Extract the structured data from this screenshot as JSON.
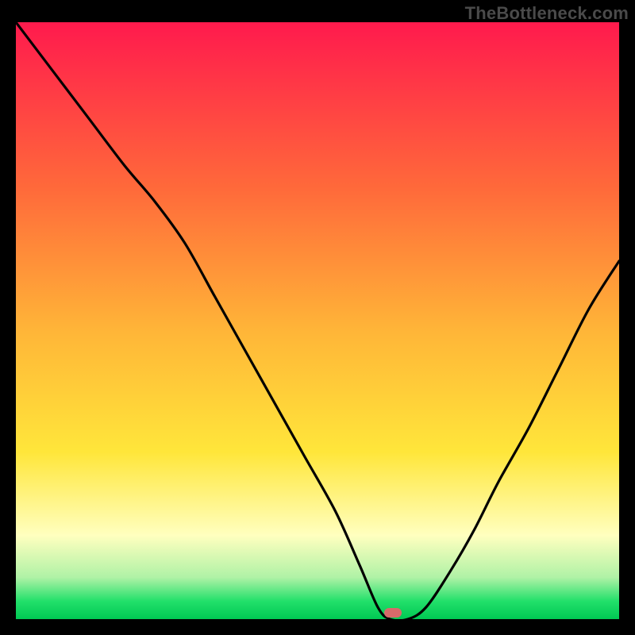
{
  "watermark": "TheBottleneck.com",
  "colors": {
    "top": "#ff1a4d",
    "mid1": "#ff6a3a",
    "mid2": "#ffb638",
    "mid3": "#ffe63a",
    "pale": "#ffffbf",
    "paleGreen": "#b0f2a6",
    "green": "#22e06a",
    "greenDeep": "#00c853",
    "curve": "#000000",
    "marker": "#d86a6a",
    "bg": "#000000"
  },
  "marker": {
    "x_pct": 62.5,
    "y_pct": 99.0
  },
  "chart_data": {
    "type": "line",
    "title": "",
    "xlabel": "",
    "ylabel": "",
    "xlim": [
      0,
      100
    ],
    "ylim": [
      0,
      100
    ],
    "grid": false,
    "x": [
      0,
      6,
      12,
      18,
      23,
      28,
      33,
      38,
      43,
      48,
      53,
      57,
      60,
      62,
      65,
      68,
      72,
      76,
      80,
      85,
      90,
      95,
      100
    ],
    "values": [
      100,
      92,
      84,
      76,
      70,
      63,
      54,
      45,
      36,
      27,
      18,
      9,
      2,
      0,
      0,
      2,
      8,
      15,
      23,
      32,
      42,
      52,
      60
    ],
    "series": [
      {
        "name": "bottleneck-curve",
        "values": [
          100,
          92,
          84,
          76,
          70,
          63,
          54,
          45,
          36,
          27,
          18,
          9,
          2,
          0,
          0,
          2,
          8,
          15,
          23,
          32,
          42,
          52,
          60
        ]
      }
    ],
    "annotations": [
      {
        "kind": "marker",
        "x": 62.5,
        "y": 0
      }
    ],
    "legend": false
  }
}
